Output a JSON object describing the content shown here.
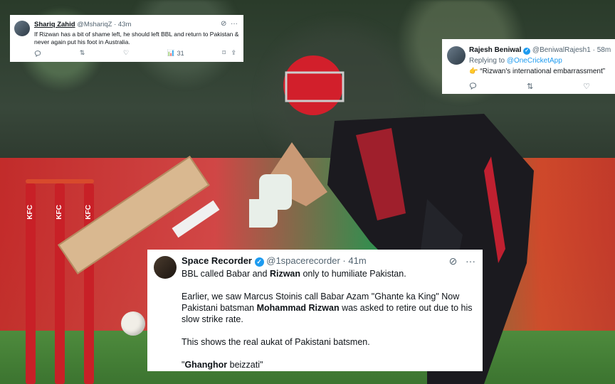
{
  "background": {
    "stump_label": "KFC"
  },
  "tweet1": {
    "name": "Shariq Zahid",
    "handle": "@MshariqZ",
    "time": "43m",
    "text": "If Rizwan has a bit of shame left, he should left BBL and return to Pakistan & never again put his foot in Australia.",
    "views": "31",
    "icons": [
      "grok-icon",
      "more-icon",
      "reply-icon",
      "retweet-icon",
      "like-icon",
      "views-icon",
      "bookmark-icon",
      "share-icon"
    ]
  },
  "tweet2": {
    "name": "Rajesh Beniwal",
    "handle": "@BeniwalRajesh1",
    "time": "58m",
    "replying_prefix": "Replying to",
    "replying_handle": "@OneCricketApp",
    "emoji": "👉",
    "text": "“Rizwan's international embarrassment”",
    "icons": [
      "reply-icon",
      "retweet-icon",
      "like-icon"
    ]
  },
  "tweet3": {
    "name": "Space Recorder",
    "handle": "@1spacerecorder",
    "time": "41m",
    "line1_a": "BBL called Babar and ",
    "line1_b": "Rizwan",
    "line1_c": " only to humiliate Pakistan.",
    "para2_a": "Earlier, we saw Marcus Stoinis call Babar Azam \"Ghante ka King\" Now Pakistani batsman ",
    "para2_b": "Mohammad Rizwan",
    "para2_c": " was asked to retire out due to his slow strike rate.",
    "para3": "This shows the real aukat  of Pakistani batsmen.",
    "para4_a": "\"",
    "para4_b": "Ghanghor",
    "para4_c": " beizzati\"",
    "verified_color": "#1d9bf0"
  }
}
